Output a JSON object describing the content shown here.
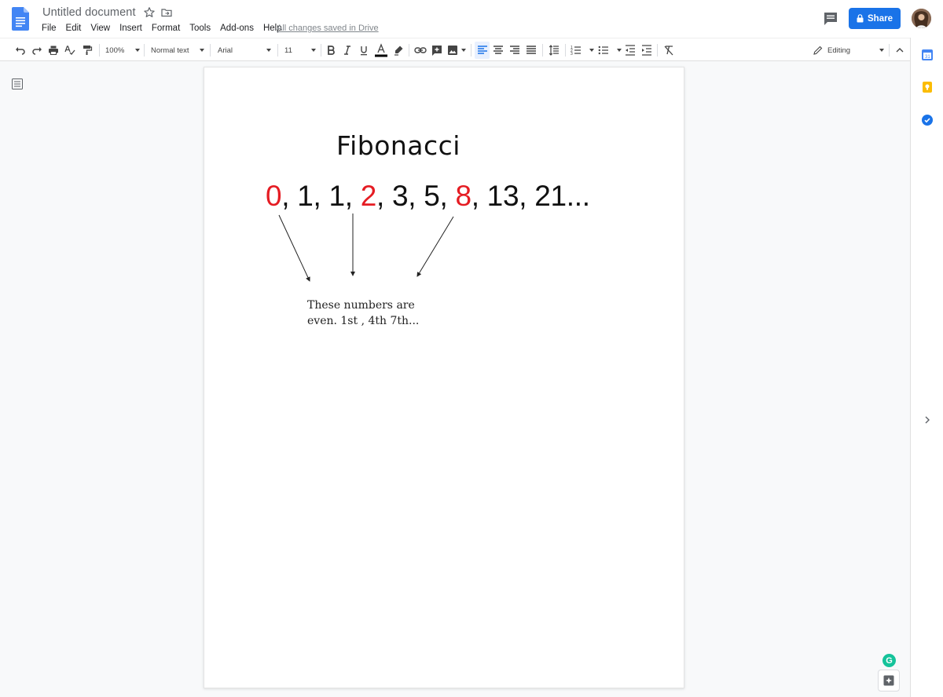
{
  "header": {
    "title": "Untitled document",
    "menu": [
      "File",
      "Edit",
      "View",
      "Insert",
      "Format",
      "Tools",
      "Add-ons",
      "Help"
    ],
    "saved_status": "All changes saved in Drive",
    "share_label": "Share"
  },
  "toolbar": {
    "zoom": "100%",
    "style": "Normal text",
    "font": "Arial",
    "font_size": "11",
    "mode": "Editing"
  },
  "document": {
    "title": "Fibonacci",
    "sequence": [
      {
        "text": "0",
        "even": true
      },
      {
        "text": ", 1, 1, ",
        "even": false
      },
      {
        "text": "2",
        "even": true
      },
      {
        "text": ", 3, 5, ",
        "even": false
      },
      {
        "text": "8",
        "even": true
      },
      {
        "text": ", 13, 21...",
        "even": false
      }
    ],
    "note_line1": "These numbers are",
    "note_line2": "even. 1st , 4th 7th..."
  },
  "colors": {
    "accent": "#1a73e8",
    "even_number": "#e51c23",
    "grammarly": "#15c39a"
  },
  "icons": [
    "docs-logo-icon",
    "star-icon",
    "move-folder-icon",
    "comment-icon",
    "lock-icon",
    "undo-icon",
    "redo-icon",
    "print-icon",
    "spellcheck-icon",
    "paint-format-icon",
    "bold-icon",
    "italic-icon",
    "underline-icon",
    "text-color-icon",
    "highlight-icon",
    "link-icon",
    "insert-comment-icon",
    "insert-image-icon",
    "align-left-icon",
    "align-center-icon",
    "align-right-icon",
    "justify-icon",
    "line-spacing-icon",
    "numbered-list-icon",
    "bulleted-list-icon",
    "decrease-indent-icon",
    "increase-indent-icon",
    "clear-formatting-icon",
    "pencil-icon",
    "collapse-icon",
    "outline-icon",
    "calendar-icon",
    "keep-icon",
    "tasks-icon",
    "chevron-right-icon",
    "grammarly-icon",
    "explore-icon"
  ]
}
